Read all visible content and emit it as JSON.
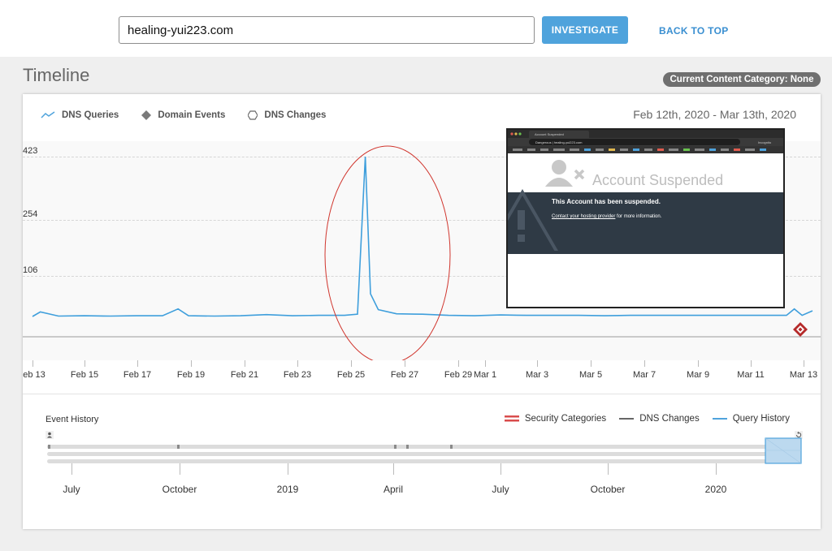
{
  "search": {
    "value": "healing-yui223.com"
  },
  "toolbar": {
    "investigate_label": "INVESTIGATE",
    "back_to_top_label": "BACK TO TOP"
  },
  "page": {
    "title": "Timeline",
    "category_badge": "Current Content Category: None"
  },
  "timeline": {
    "legend": {
      "dns_queries": "DNS Queries",
      "domain_events": "Domain Events",
      "dns_changes": "DNS Changes"
    },
    "date_range": "Feb 12th, 2020 - Mar 13th, 2020",
    "y_ticks": [
      "423",
      "254",
      "106"
    ],
    "x_ticks": [
      "eb 13",
      "Feb 15",
      "Feb 17",
      "Feb 19",
      "Feb 21",
      "Feb 23",
      "Feb 25",
      "Feb 27",
      "Feb 29",
      "Mar 1",
      "Mar 3",
      "Mar 5",
      "Mar 7",
      "Mar 9",
      "Mar 11",
      "Mar 13"
    ],
    "line_color": "#3f9fdc",
    "annotation_color": "#d0342c"
  },
  "chart_data": {
    "type": "line",
    "series": [
      {
        "name": "DNS Queries",
        "x": [
          0,
          0.3,
          1,
          2,
          3,
          4,
          5,
          5.6,
          6,
          7,
          8,
          9,
          10,
          11,
          12,
          12.5,
          12.8,
          13,
          13.3,
          14,
          15,
          16,
          17,
          18,
          19,
          20,
          21,
          22,
          23,
          24,
          25,
          26,
          27,
          28,
          29,
          29.3,
          29.6,
          30
        ],
        "y": [
          0,
          12,
          1,
          2,
          1,
          2,
          2,
          20,
          2,
          1,
          2,
          5,
          2,
          3,
          3,
          6,
          423,
          60,
          18,
          7,
          6,
          3,
          2,
          4,
          3,
          3,
          3,
          2,
          3,
          3,
          3,
          3,
          3,
          3,
          3,
          20,
          3,
          15
        ]
      }
    ],
    "ylim": [
      0,
      460
    ],
    "xlim": [
      0,
      30
    ]
  },
  "popup": {
    "tab_title": "Account Suspended",
    "url_host": "Dangerous | healing-yui223.com",
    "headline": "Account Suspended",
    "message": "This Account has been suspended.",
    "link_text": "Contact your hosting provider",
    "link_suffix": " for more information.",
    "profile_label": "Incognito"
  },
  "event_history": {
    "title": "Event History",
    "legend": {
      "security": "Security Categories",
      "dns_changes": "DNS Changes",
      "query_history": "Query History"
    },
    "security_color": "#d94c4c",
    "dns_changes_color": "#666666",
    "query_history_color": "#4fa3dc",
    "ticks": [
      "July",
      "October",
      "2019",
      "April",
      "July",
      "October",
      "2020"
    ]
  }
}
